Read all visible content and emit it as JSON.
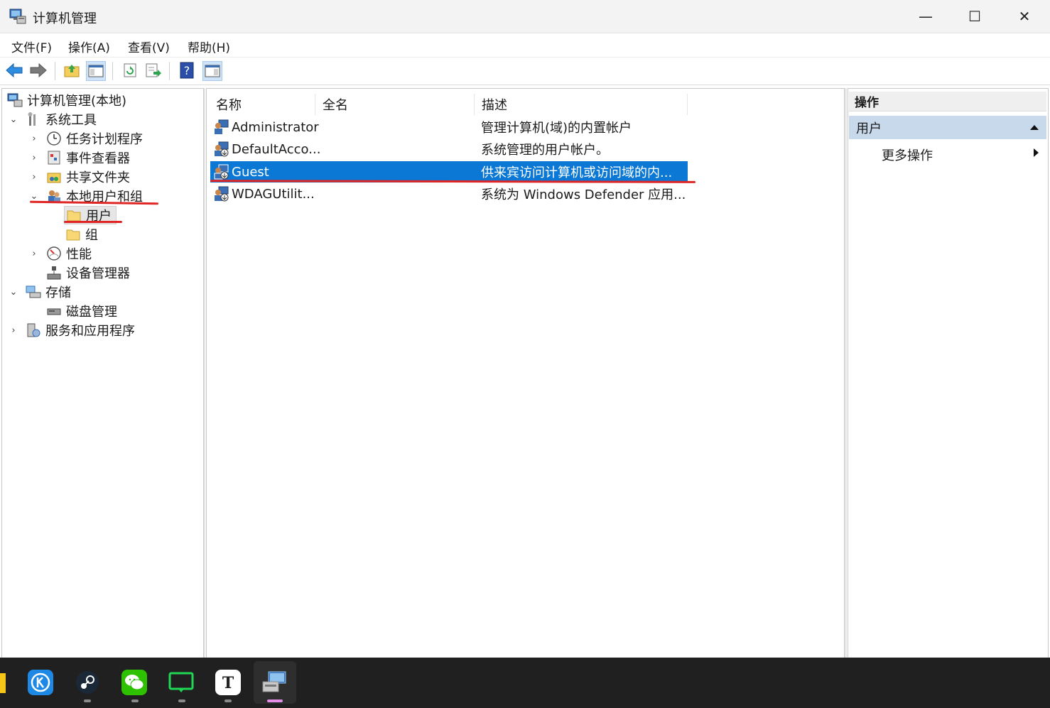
{
  "window": {
    "title": "计算机管理",
    "minimize": "—",
    "maximize": "☐",
    "close": "✕"
  },
  "menu": [
    "文件(F)",
    "操作(A)",
    "查看(V)",
    "帮助(H)"
  ],
  "tree": {
    "root": "计算机管理(本地)",
    "system_tools": "系统工具",
    "task_scheduler": "任务计划程序",
    "event_viewer": "事件查看器",
    "shared_folders": "共享文件夹",
    "local_users_groups": "本地用户和组",
    "users": "用户",
    "groups": "组",
    "performance": "性能",
    "device_manager": "设备管理器",
    "storage": "存储",
    "disk_management": "磁盘管理",
    "services_apps": "服务和应用程序"
  },
  "list": {
    "columns": [
      "名称",
      "全名",
      "描述"
    ],
    "rows": [
      {
        "name": "Administrator",
        "fullname": "",
        "description": "管理计算机(域)的内置帐户",
        "selected": false
      },
      {
        "name": "DefaultAcco...",
        "fullname": "",
        "description": "系统管理的用户帐户。",
        "selected": false
      },
      {
        "name": "Guest",
        "fullname": "",
        "description": "供来宾访问计算机或访问域的内...",
        "selected": true
      },
      {
        "name": "WDAGUtilit...",
        "fullname": "",
        "description": "系统为 Windows Defender 应用...",
        "selected": false
      }
    ]
  },
  "actions": {
    "header": "操作",
    "section": "用户",
    "more": "更多操作"
  },
  "colors": {
    "selection": "#0a78d4",
    "annotation": "#e02525",
    "taskbar": "#202020"
  },
  "taskbar_apps": [
    "k-app-icon",
    "steam-icon",
    "wechat-icon",
    "chat-icon",
    "typora-icon",
    "computer-management-icon"
  ]
}
